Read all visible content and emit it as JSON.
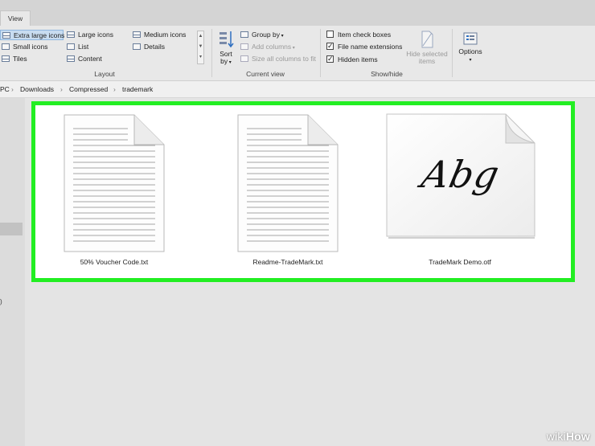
{
  "tabs": {
    "view": "View"
  },
  "layout": {
    "label": "Layout",
    "items": [
      "Extra large icons",
      "Large icons",
      "Medium icons",
      "Small icons",
      "List",
      "Details",
      "Tiles",
      "Content"
    ]
  },
  "current_view": {
    "label": "Current view",
    "sort_by_line1": "Sort",
    "sort_by_line2": "by",
    "group_by": "Group by",
    "add_columns": "Add columns",
    "size_all_columns": "Size all columns to fit"
  },
  "show_hide": {
    "label": "Show/hide",
    "item_check_boxes": "Item check boxes",
    "file_name_extensions": "File name extensions",
    "hidden_items": "Hidden items",
    "hide_selected_line1": "Hide selected",
    "hide_selected_line2": "items",
    "options": "Options"
  },
  "breadcrumb": {
    "pc": "PC",
    "downloads": "Downloads",
    "compressed": "Compressed",
    "trademark": "trademark"
  },
  "sidebar": {
    "partial_text": ")"
  },
  "files": [
    {
      "name": "50% Voucher Code.txt"
    },
    {
      "name": "Readme-TradeMark.txt"
    },
    {
      "name": "TradeMark Demo.otf",
      "preview": "Abg"
    }
  ],
  "watermark": {
    "wiki": "wiki",
    "how": "How"
  }
}
